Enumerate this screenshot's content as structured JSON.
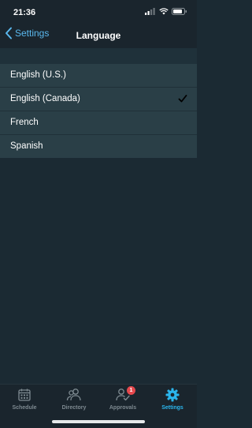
{
  "status_bar": {
    "time": "21:36"
  },
  "nav": {
    "back_label": "Settings",
    "title": "Language"
  },
  "languages": [
    {
      "label": "English (U.S.)",
      "selected": false
    },
    {
      "label": "English (Canada)",
      "selected": true
    },
    {
      "label": "French",
      "selected": false
    },
    {
      "label": "Spanish",
      "selected": false
    }
  ],
  "tabs": [
    {
      "label": "Schedule",
      "icon": "calendar-icon",
      "active": false
    },
    {
      "label": "Directory",
      "icon": "people-icon",
      "active": false
    },
    {
      "label": "Approvals",
      "icon": "approvals-icon",
      "active": false,
      "badge": "1"
    },
    {
      "label": "Settings",
      "icon": "gear-icon",
      "active": true
    }
  ],
  "colors": {
    "accent": "#2bb5ec",
    "background": "#1b2a33",
    "list_background": "#2a3f47",
    "badge": "#e5484d"
  }
}
